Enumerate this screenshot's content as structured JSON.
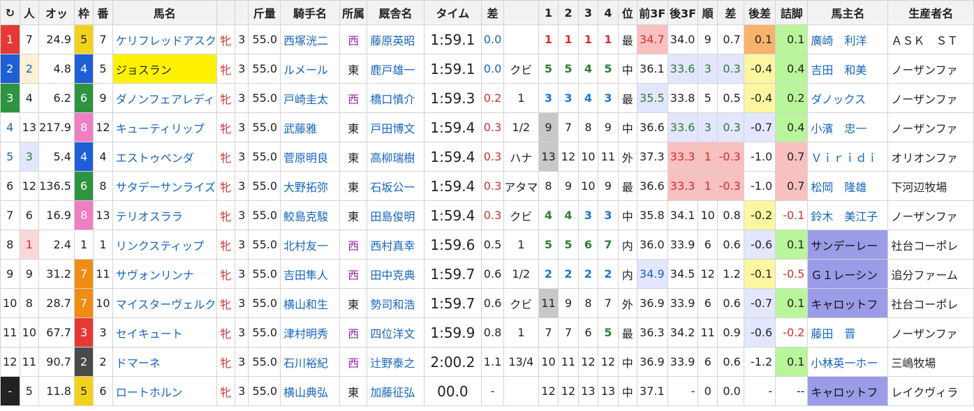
{
  "headers": [
    "↻",
    "人",
    "オッ",
    "枠",
    "番",
    "馬名",
    "",
    "",
    "斤量",
    "騎手名",
    "所属",
    "厩舎名",
    "タイム",
    "差",
    "",
    "1",
    "2",
    "3",
    "4",
    "位",
    "前3F",
    "後3F",
    "順",
    "差",
    "後差",
    "詰脚",
    "馬主名",
    "生産者名"
  ],
  "rows": [
    {
      "rank": "1",
      "ninki": "7",
      "odds": "24.9",
      "waku": "5",
      "ban": "7",
      "horse": "ケリフレッドアスク",
      "sex": "牝",
      "age": "3",
      "kin": "55.0",
      "jockey": "西塚洸二",
      "shozoku": "西",
      "trainer": "藤原英昭",
      "time": "1:59.1",
      "diff": "0.0",
      "chakusa": "",
      "c1": "1",
      "c2": "1",
      "c3": "1",
      "c4": "1",
      "pos": "最",
      "f3": "34.7",
      "l3": "34.0",
      "jun": "9",
      "sa": "0.7",
      "atosa": "0.1",
      "tsume": "0.1",
      "owner": "廣崎　利洋",
      "breeder": "ＡＳＫ　ＳＴ"
    },
    {
      "rank": "2",
      "ninki": "2",
      "odds": "4.8",
      "waku": "4",
      "ban": "5",
      "horse": "ジョスラン",
      "sex": "牝",
      "age": "3",
      "kin": "55.0",
      "jockey": "ルメール",
      "shozoku": "東",
      "trainer": "鹿戸雄一",
      "time": "1:59.1",
      "diff": "0.0",
      "chakusa": "クビ",
      "c1": "5",
      "c2": "5",
      "c3": "4",
      "c4": "5",
      "pos": "中",
      "f3": "36.1",
      "l3": "33.6",
      "jun": "3",
      "sa": "0.3",
      "atosa": "-0.4",
      "tsume": "0.4",
      "owner": "吉田　和美",
      "breeder": "ノーザンファ"
    },
    {
      "rank": "3",
      "ninki": "4",
      "odds": "6.2",
      "waku": "6",
      "ban": "9",
      "horse": "ダノンフェアレディ",
      "sex": "牝",
      "age": "3",
      "kin": "55.0",
      "jockey": "戸崎圭太",
      "shozoku": "西",
      "trainer": "橋口慎介",
      "time": "1:59.3",
      "diff": "0.2",
      "chakusa": "1",
      "c1": "3",
      "c2": "3",
      "c3": "4",
      "c4": "3",
      "pos": "最",
      "f3": "35.5",
      "l3": "33.8",
      "jun": "5",
      "sa": "0.5",
      "atosa": "-0.4",
      "tsume": "0.2",
      "owner": "ダノックス",
      "breeder": "ノーザンファ"
    },
    {
      "rank": "4",
      "ninki": "13",
      "odds": "217.9",
      "waku": "8",
      "ban": "12",
      "horse": "キューティリップ",
      "sex": "牝",
      "age": "3",
      "kin": "55.0",
      "jockey": "武藤雅",
      "shozoku": "東",
      "trainer": "戸田博文",
      "time": "1:59.4",
      "diff": "0.3",
      "chakusa": "1/2",
      "c1": "9",
      "c2": "7",
      "c3": "8",
      "c4": "9",
      "pos": "中",
      "f3": "36.6",
      "l3": "33.6",
      "jun": "3",
      "sa": "0.3",
      "atosa": "-0.7",
      "tsume": "0.4",
      "owner": "小濱　忠一",
      "breeder": "ノーザンファ"
    },
    {
      "rank": "5",
      "ninki": "3",
      "odds": "5.4",
      "waku": "4",
      "ban": "4",
      "horse": "エストゥペンダ",
      "sex": "牝",
      "age": "3",
      "kin": "55.0",
      "jockey": "菅原明良",
      "shozoku": "東",
      "trainer": "高柳瑞樹",
      "time": "1:59.4",
      "diff": "0.3",
      "chakusa": "ハナ",
      "c1": "13",
      "c2": "12",
      "c3": "10",
      "c4": "11",
      "pos": "外",
      "f3": "37.3",
      "l3": "33.3",
      "jun": "1",
      "sa": "-0.3",
      "atosa": "-1.0",
      "tsume": "0.7",
      "owner": "Ｖｉｒｉｄｉ",
      "breeder": "オリオンファ"
    },
    {
      "rank": "6",
      "ninki": "12",
      "odds": "136.5",
      "waku": "6",
      "ban": "8",
      "horse": "サタデーサンライズ",
      "sex": "牝",
      "age": "3",
      "kin": "55.0",
      "jockey": "大野拓弥",
      "shozoku": "東",
      "trainer": "石坂公一",
      "time": "1:59.4",
      "diff": "0.3",
      "chakusa": "アタマ",
      "c1": "8",
      "c2": "9",
      "c3": "10",
      "c4": "9",
      "pos": "最",
      "f3": "36.6",
      "l3": "33.3",
      "jun": "1",
      "sa": "-0.3",
      "atosa": "-1.0",
      "tsume": "0.7",
      "owner": "松岡　隆雄",
      "breeder": "下河辺牧場"
    },
    {
      "rank": "7",
      "ninki": "6",
      "odds": "16.9",
      "waku": "8",
      "ban": "13",
      "horse": "テリオスララ",
      "sex": "牝",
      "age": "3",
      "kin": "55.0",
      "jockey": "鮫島克駿",
      "shozoku": "東",
      "trainer": "田島俊明",
      "time": "1:59.4",
      "diff": "0.3",
      "chakusa": "クビ",
      "c1": "4",
      "c2": "4",
      "c3": "3",
      "c4": "3",
      "pos": "中",
      "f3": "35.8",
      "l3": "34.1",
      "jun": "10",
      "sa": "0.8",
      "atosa": "-0.2",
      "tsume": "-0.1",
      "owner": "鈴木　美江子",
      "breeder": "ノーザンファ"
    },
    {
      "rank": "8",
      "ninki": "1",
      "odds": "2.4",
      "waku": "1",
      "ban": "1",
      "horse": "リンクスティップ",
      "sex": "牝",
      "age": "3",
      "kin": "55.0",
      "jockey": "北村友一",
      "shozoku": "西",
      "trainer": "西村真幸",
      "time": "1:59.6",
      "diff": "0.5",
      "chakusa": "1",
      "c1": "5",
      "c2": "5",
      "c3": "6",
      "c4": "7",
      "pos": "内",
      "f3": "36.0",
      "l3": "33.9",
      "jun": "6",
      "sa": "0.6",
      "atosa": "-0.6",
      "tsume": "0.1",
      "owner": "サンデーレー",
      "breeder": "社台コーポレ"
    },
    {
      "rank": "9",
      "ninki": "9",
      "odds": "31.2",
      "waku": "7",
      "ban": "11",
      "horse": "サヴォンリンナ",
      "sex": "牝",
      "age": "3",
      "kin": "55.0",
      "jockey": "吉田隼人",
      "shozoku": "西",
      "trainer": "田中克典",
      "time": "1:59.7",
      "diff": "0.6",
      "chakusa": "1/2",
      "c1": "2",
      "c2": "2",
      "c3": "2",
      "c4": "2",
      "pos": "内",
      "f3": "34.9",
      "l3": "34.5",
      "jun": "12",
      "sa": "1.2",
      "atosa": "-0.1",
      "tsume": "-0.5",
      "owner": "Ｇ１レーシン",
      "breeder": "追分ファーム"
    },
    {
      "rank": "10",
      "ninki": "8",
      "odds": "28.7",
      "waku": "7",
      "ban": "10",
      "horse": "マイスターヴェルク",
      "sex": "牝",
      "age": "3",
      "kin": "55.0",
      "jockey": "横山和生",
      "shozoku": "東",
      "trainer": "勢司和浩",
      "time": "1:59.7",
      "diff": "0.6",
      "chakusa": "クビ",
      "c1": "11",
      "c2": "9",
      "c3": "8",
      "c4": "7",
      "pos": "外",
      "f3": "36.9",
      "l3": "33.9",
      "jun": "6",
      "sa": "0.6",
      "atosa": "-0.7",
      "tsume": "0.1",
      "owner": "キャロットフ",
      "breeder": "社台コーポレ"
    },
    {
      "rank": "11",
      "ninki": "10",
      "odds": "67.7",
      "waku": "3",
      "ban": "3",
      "horse": "セイキュート",
      "sex": "牝",
      "age": "3",
      "kin": "55.0",
      "jockey": "津村明秀",
      "shozoku": "西",
      "trainer": "四位洋文",
      "time": "1:59.9",
      "diff": "0.8",
      "chakusa": "1",
      "c1": "7",
      "c2": "7",
      "c3": "6",
      "c4": "5",
      "pos": "最",
      "f3": "36.3",
      "l3": "34.2",
      "jun": "11",
      "sa": "0.9",
      "atosa": "-0.6",
      "tsume": "-0.2",
      "owner": "藤田　晋",
      "breeder": "ノーザンファ"
    },
    {
      "rank": "12",
      "ninki": "11",
      "odds": "90.7",
      "waku": "2",
      "ban": "2",
      "horse": "ドマーネ",
      "sex": "牝",
      "age": "3",
      "kin": "55.0",
      "jockey": "石川裕紀",
      "shozoku": "西",
      "trainer": "辻野泰之",
      "time": "2:00.2",
      "diff": "1.1",
      "chakusa": "13/4",
      "c1": "10",
      "c2": "11",
      "c3": "12",
      "c4": "12",
      "pos": "中",
      "f3": "36.9",
      "l3": "33.9",
      "jun": "6",
      "sa": "0.6",
      "atosa": "-1.2",
      "tsume": "0.1",
      "owner": "小林英一ホー",
      "breeder": "三嶋牧場"
    },
    {
      "rank": "-",
      "ninki": "5",
      "odds": "11.8",
      "waku": "5",
      "ban": "6",
      "horse": "ロートホルン",
      "sex": "牝",
      "age": "3",
      "kin": "55.0",
      "jockey": "横山典弘",
      "shozoku": "東",
      "trainer": "加藤征弘",
      "time": "00.0",
      "diff": "-",
      "chakusa": "",
      "c1": "12",
      "c2": "12",
      "c3": "13",
      "c4": "13",
      "pos": "中",
      "f3": "37.1",
      "l3": "-",
      "jun": "0",
      "sa": "0.0",
      "atosa": "-",
      "tsume": "--",
      "owner": "キャロットフ",
      "breeder": "レイクヴィラ"
    }
  ],
  "colors": {
    "waku": {
      "1": "#ffffff",
      "2": "#4a4a4a",
      "3": "#e53935",
      "4": "#1e5fd6",
      "5": "#f2d31b",
      "6": "#2e9440",
      "7": "#f08c14",
      "8": "#f07ec3"
    },
    "rank_bg": {
      "1": "#e53935",
      "2": "#1e5fd6",
      "3": "#2e9440"
    },
    "purple_owner": "#9b9ce8"
  }
}
